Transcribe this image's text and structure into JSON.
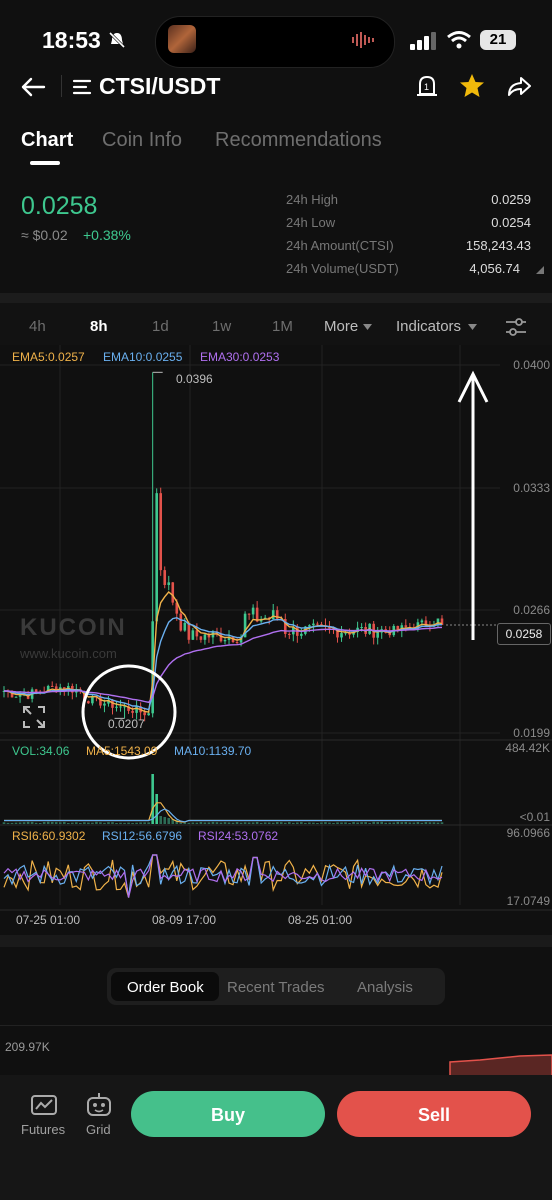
{
  "status": {
    "time": "18:53",
    "battery": "21"
  },
  "header": {
    "pair": "CTSI/USDT"
  },
  "tabs": [
    "Chart",
    "Coin Info",
    "Recommendations"
  ],
  "ticker": {
    "price": "0.0258",
    "fiat": "≈ $0.02",
    "change": "+0.38%",
    "stats": [
      {
        "label": "24h High",
        "value": "0.0259"
      },
      {
        "label": "24h Low",
        "value": "0.0254"
      },
      {
        "label": "24h Amount(CTSI)",
        "value": "158,243.43"
      },
      {
        "label": "24h Volume(USDT)",
        "value": "4,056.74"
      }
    ]
  },
  "intervals": {
    "i4h": "4h",
    "i8h": "8h",
    "i1d": "1d",
    "i1w": "1w",
    "i1M": "1M",
    "more": "More",
    "indicators": "Indicators"
  },
  "legend": {
    "ema5": "EMA5:0.0257",
    "ema10": "EMA10:0.0255",
    "ema30": "EMA30:0.0253",
    "vol": "VOL:34.06",
    "ma5": "MA5:1543.09",
    "ma10": "MA10:1139.70",
    "rsi6": "RSI6:60.9302",
    "rsi12": "RSI12:56.6796",
    "rsi24": "RSI24:53.0762"
  },
  "axis": {
    "y": [
      "0.0400",
      "0.0333",
      "0.0266",
      "0.0199"
    ],
    "vol": [
      "484.42K",
      "<0.01"
    ],
    "rsi": [
      "96.0966",
      "17.0749"
    ],
    "x": [
      "07-25 01:00",
      "08-09 17:00",
      "08-25 01:00"
    ],
    "high_mark": "0.0396",
    "low_mark": "0.0207",
    "last_price": "0.0258"
  },
  "watermark": {
    "brand": "KUCOIN",
    "url": "www.kucoin.com"
  },
  "colors": {
    "up": "#3ec88f",
    "down": "#e3524b",
    "ema5": "#f0b24a",
    "ema10": "#6ab0f0",
    "ema30": "#b070f0"
  },
  "orderbook_tabs": [
    "Order Book",
    "Recent Trades",
    "Analysis"
  ],
  "depth": {
    "max": "209.97K"
  },
  "bottom_nav": {
    "futures": "Futures",
    "grid": "Grid",
    "buy": "Buy",
    "sell": "Sell"
  },
  "chart_data": {
    "type": "candlestick",
    "x_labels": [
      "07-25 01:00",
      "08-09 17:00",
      "08-25 01:00"
    ],
    "ylim": [
      0.0199,
      0.04
    ],
    "high": 0.0396,
    "low": 0.0207,
    "last": 0.0258,
    "series": [
      {
        "name": "EMA5",
        "last": 0.0257
      },
      {
        "name": "EMA10",
        "last": 0.0255
      },
      {
        "name": "EMA30",
        "last": 0.0253
      }
    ],
    "volume": {
      "VOL": 34.06,
      "MA5": 1543.09,
      "MA10": 1139.7,
      "max": "484.42K"
    },
    "rsi": {
      "RSI6": 60.9302,
      "RSI12": 56.6796,
      "RSI24": 53.0762,
      "range": [
        17.0749,
        96.0966
      ]
    }
  }
}
